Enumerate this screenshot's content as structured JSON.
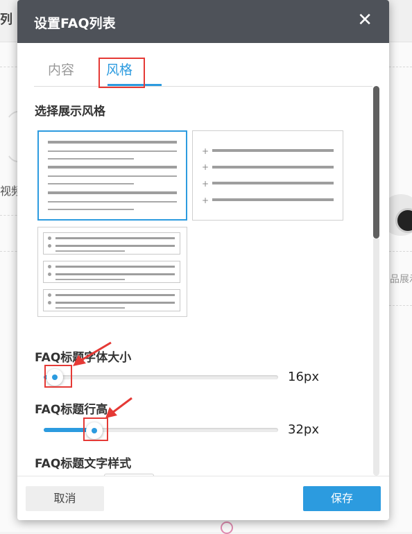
{
  "background": {
    "left_label": "列",
    "video_label": "视频",
    "product_label": "品展示"
  },
  "modal": {
    "title": "设置FAQ列表",
    "close_icon": "close-icon"
  },
  "tabs": [
    {
      "label": "内容",
      "active": false
    },
    {
      "label": "风格",
      "active": true
    }
  ],
  "style_section": {
    "title": "选择展示风格",
    "options": [
      {
        "name": "lines-list",
        "selected": true
      },
      {
        "name": "plus-list",
        "selected": false
      },
      {
        "name": "boxed-list",
        "selected": false
      }
    ]
  },
  "font_size": {
    "title": "FAQ标题字体大小",
    "value": "16px",
    "fill_fraction": 0.06
  },
  "line_height": {
    "title": "FAQ标题行高",
    "value": "32px",
    "fill_fraction": 0.24
  },
  "text_style": {
    "title": "FAQ标题文字样式"
  },
  "footer": {
    "cancel_label": "取消",
    "save_label": "保存"
  },
  "colors": {
    "accent": "#2c9bdf",
    "header_bg": "#4e5259",
    "annotation": "#e53935"
  }
}
